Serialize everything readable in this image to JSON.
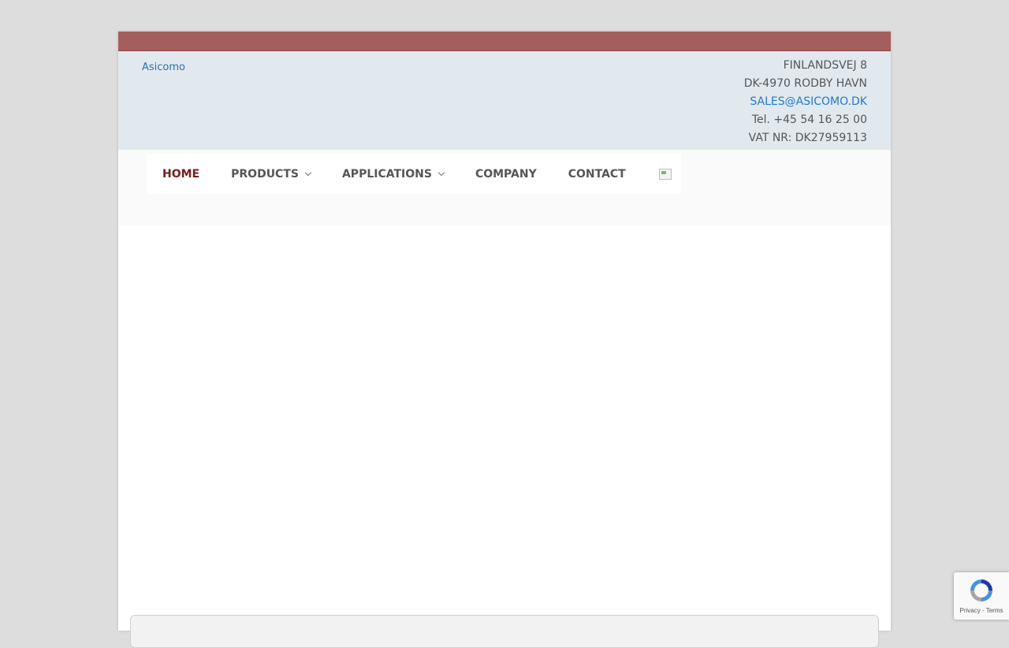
{
  "header": {
    "logo_alt": "Asicomo",
    "address_line1": "FINLANDSVEJ 8",
    "address_line2": "DK-4970 RODBY HAVN",
    "email": "SALES@ASICOMO.DK",
    "phone": "Tel. +45 54 16 25 00",
    "vat": "VAT NR: DK27959113"
  },
  "nav": {
    "home": "HOME",
    "products": "PRODUCTS",
    "applications": "APPLICATIONS",
    "company": "COMPANY",
    "contact": "CONTACT"
  },
  "recaptcha": {
    "links": "Privacy - Terms"
  },
  "colors": {
    "top_bar": "#a55e5e",
    "header_bg": "#e2e9ee",
    "nav_active": "#7a1b1b",
    "link": "#1f78d1"
  }
}
